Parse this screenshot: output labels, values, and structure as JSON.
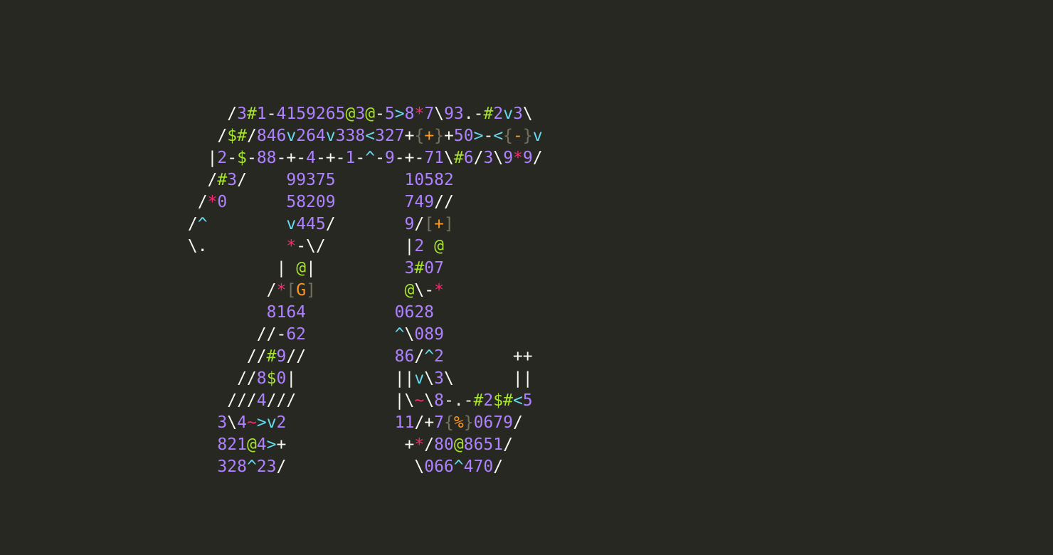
{
  "colors": {
    "background": "#272822",
    "w": "#f8f8f2",
    "p": "#ae81ff",
    "g": "#a6e22e",
    "c": "#66d9ef",
    "r": "#f92672",
    "o": "#fd971f",
    "d": "#75715e"
  },
  "art": {
    "lines": [
      [
        [
          "     /",
          "w"
        ],
        [
          "3",
          "p"
        ],
        [
          "#",
          "g"
        ],
        [
          "1",
          "p"
        ],
        [
          "-",
          "w"
        ],
        [
          "4159265",
          "p"
        ],
        [
          "@",
          "g"
        ],
        [
          "3",
          "p"
        ],
        [
          "@",
          "g"
        ],
        [
          "-",
          "w"
        ],
        [
          "5",
          "p"
        ],
        [
          ">",
          "c"
        ],
        [
          "8",
          "p"
        ],
        [
          "*",
          "r"
        ],
        [
          "7",
          "p"
        ],
        [
          "\\",
          "w"
        ],
        [
          "93",
          "p"
        ],
        [
          ".",
          "w"
        ],
        [
          "-",
          "w"
        ],
        [
          "#",
          "g"
        ],
        [
          "2",
          "p"
        ],
        [
          "v",
          "c"
        ],
        [
          "3",
          "p"
        ],
        [
          "\\",
          "w"
        ]
      ],
      [
        [
          "    /",
          "w"
        ],
        [
          "$",
          "g"
        ],
        [
          "#",
          "g"
        ],
        [
          "/",
          "w"
        ],
        [
          "846",
          "p"
        ],
        [
          "v",
          "c"
        ],
        [
          "264",
          "p"
        ],
        [
          "v",
          "c"
        ],
        [
          "338",
          "p"
        ],
        [
          "<",
          "c"
        ],
        [
          "327",
          "p"
        ],
        [
          "+",
          "w"
        ],
        [
          "{",
          "d"
        ],
        [
          "+",
          "o"
        ],
        [
          "}",
          "d"
        ],
        [
          "+",
          "w"
        ],
        [
          "50",
          "p"
        ],
        [
          ">",
          "c"
        ],
        [
          "-",
          "w"
        ],
        [
          "<",
          "c"
        ],
        [
          "{",
          "d"
        ],
        [
          "-",
          "o"
        ],
        [
          "}",
          "d"
        ],
        [
          "v",
          "c"
        ]
      ],
      [
        [
          "   |",
          "w"
        ],
        [
          "2",
          "p"
        ],
        [
          "-",
          "w"
        ],
        [
          "$",
          "g"
        ],
        [
          "-",
          "w"
        ],
        [
          "88",
          "p"
        ],
        [
          "-+-",
          "w"
        ],
        [
          "4",
          "p"
        ],
        [
          "-+-",
          "w"
        ],
        [
          "1",
          "p"
        ],
        [
          "-",
          "w"
        ],
        [
          "^",
          "c"
        ],
        [
          "-",
          "w"
        ],
        [
          "9",
          "p"
        ],
        [
          "-+-",
          "w"
        ],
        [
          "71",
          "p"
        ],
        [
          "\\",
          "w"
        ],
        [
          "#",
          "g"
        ],
        [
          "6",
          "p"
        ],
        [
          "/",
          "w"
        ],
        [
          "3",
          "p"
        ],
        [
          "\\",
          "w"
        ],
        [
          "9",
          "p"
        ],
        [
          "*",
          "r"
        ],
        [
          "9",
          "p"
        ],
        [
          "/",
          "w"
        ]
      ],
      [
        [
          "   /",
          "w"
        ],
        [
          "#",
          "g"
        ],
        [
          "3",
          "p"
        ],
        [
          "/",
          "w"
        ],
        [
          "    ",
          "w"
        ],
        [
          "99375",
          "p"
        ],
        [
          "       ",
          "w"
        ],
        [
          "10582",
          "p"
        ]
      ],
      [
        [
          "  /",
          "w"
        ],
        [
          "*",
          "r"
        ],
        [
          "0",
          "p"
        ],
        [
          "      ",
          "w"
        ],
        [
          "58209",
          "p"
        ],
        [
          "       ",
          "w"
        ],
        [
          "749",
          "p"
        ],
        [
          "//",
          "w"
        ]
      ],
      [
        [
          " /",
          "w"
        ],
        [
          "^",
          "c"
        ],
        [
          "        ",
          "w"
        ],
        [
          "v",
          "c"
        ],
        [
          "445",
          "p"
        ],
        [
          "/",
          "w"
        ],
        [
          "       ",
          "w"
        ],
        [
          "9",
          "p"
        ],
        [
          "/",
          "w"
        ],
        [
          "[",
          "d"
        ],
        [
          "+",
          "o"
        ],
        [
          "]",
          "d"
        ]
      ],
      [
        [
          " \\.",
          "w"
        ],
        [
          "        ",
          "w"
        ],
        [
          "*",
          "r"
        ],
        [
          "-\\/",
          "w"
        ],
        [
          "        ",
          "w"
        ],
        [
          "|",
          "w"
        ],
        [
          "2",
          "p"
        ],
        [
          " ",
          "w"
        ],
        [
          "@",
          "g"
        ]
      ],
      [
        [
          "          ",
          "w"
        ],
        [
          "| ",
          "w"
        ],
        [
          "@",
          "g"
        ],
        [
          "|",
          "w"
        ],
        [
          "         ",
          "w"
        ],
        [
          "3",
          "p"
        ],
        [
          "#",
          "g"
        ],
        [
          "07",
          "p"
        ]
      ],
      [
        [
          "         /",
          "w"
        ],
        [
          "*",
          "r"
        ],
        [
          "[",
          "d"
        ],
        [
          "G",
          "o"
        ],
        [
          "]",
          "d"
        ],
        [
          "         ",
          "w"
        ],
        [
          "@",
          "g"
        ],
        [
          "\\-",
          "w"
        ],
        [
          "*",
          "r"
        ]
      ],
      [
        [
          "         ",
          "w"
        ],
        [
          "8164",
          "p"
        ],
        [
          "         ",
          "w"
        ],
        [
          "0628",
          "p"
        ]
      ],
      [
        [
          "        //-",
          "w"
        ],
        [
          "62",
          "p"
        ],
        [
          "         ",
          "w"
        ],
        [
          "^",
          "c"
        ],
        [
          "\\",
          "w"
        ],
        [
          "089",
          "p"
        ]
      ],
      [
        [
          "       //",
          "w"
        ],
        [
          "#",
          "g"
        ],
        [
          "9",
          "p"
        ],
        [
          "//",
          "w"
        ],
        [
          "         ",
          "w"
        ],
        [
          "86",
          "p"
        ],
        [
          "/",
          "w"
        ],
        [
          "^",
          "c"
        ],
        [
          "2",
          "p"
        ],
        [
          "       ++",
          "w"
        ]
      ],
      [
        [
          "      //",
          "w"
        ],
        [
          "8",
          "p"
        ],
        [
          "$",
          "g"
        ],
        [
          "0",
          "p"
        ],
        [
          "|",
          "w"
        ],
        [
          "          ",
          "w"
        ],
        [
          "||",
          "w"
        ],
        [
          "v",
          "c"
        ],
        [
          "\\",
          "w"
        ],
        [
          "3",
          "p"
        ],
        [
          "\\",
          "w"
        ],
        [
          "      ||",
          "w"
        ]
      ],
      [
        [
          "     ///",
          "w"
        ],
        [
          "4",
          "p"
        ],
        [
          "///",
          "w"
        ],
        [
          "          ",
          "w"
        ],
        [
          "|\\",
          "w"
        ],
        [
          "~",
          "r"
        ],
        [
          "\\",
          "w"
        ],
        [
          "8",
          "p"
        ],
        [
          "-.-",
          "w"
        ],
        [
          "#",
          "g"
        ],
        [
          "2",
          "p"
        ],
        [
          "$",
          "g"
        ],
        [
          "#",
          "g"
        ],
        [
          "<",
          "c"
        ],
        [
          "5",
          "p"
        ]
      ],
      [
        [
          "    ",
          "w"
        ],
        [
          "3",
          "p"
        ],
        [
          "\\",
          "w"
        ],
        [
          "4",
          "p"
        ],
        [
          "~",
          "r"
        ],
        [
          ">",
          "c"
        ],
        [
          "v",
          "c"
        ],
        [
          "2",
          "p"
        ],
        [
          "           ",
          "w"
        ],
        [
          "11",
          "p"
        ],
        [
          "/+",
          "w"
        ],
        [
          "7",
          "p"
        ],
        [
          "{",
          "d"
        ],
        [
          "%",
          "o"
        ],
        [
          "}",
          "d"
        ],
        [
          "0679",
          "p"
        ],
        [
          "/",
          "w"
        ]
      ],
      [
        [
          "    ",
          "w"
        ],
        [
          "821",
          "p"
        ],
        [
          "@",
          "g"
        ],
        [
          "4",
          "p"
        ],
        [
          ">",
          "c"
        ],
        [
          "+",
          "w"
        ],
        [
          "            +",
          "w"
        ],
        [
          "*",
          "r"
        ],
        [
          "/",
          "w"
        ],
        [
          "80",
          "p"
        ],
        [
          "@",
          "g"
        ],
        [
          "8651",
          "p"
        ],
        [
          "/",
          "w"
        ]
      ],
      [
        [
          "    ",
          "w"
        ],
        [
          "328",
          "p"
        ],
        [
          "^",
          "c"
        ],
        [
          "23",
          "p"
        ],
        [
          "/",
          "w"
        ],
        [
          "             \\",
          "w"
        ],
        [
          "066",
          "p"
        ],
        [
          "^",
          "c"
        ],
        [
          "470",
          "p"
        ],
        [
          "/",
          "w"
        ]
      ]
    ]
  }
}
